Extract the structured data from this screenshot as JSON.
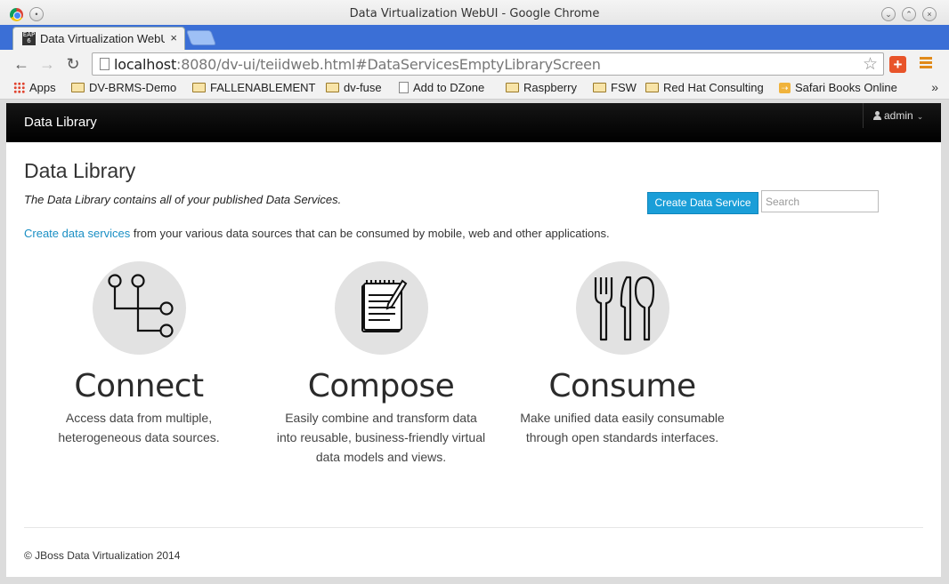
{
  "window": {
    "title": "Data Virtualization WebUI - Google Chrome"
  },
  "tab": {
    "title": "Data Virtualization WebUI",
    "favicon_text": "EAP 6"
  },
  "omnibox": {
    "host": "localhost",
    "path": ":8080/dv-ui/teiidweb.html#DataServicesEmptyLibraryScreen"
  },
  "bookmarks": [
    {
      "label": "Apps",
      "icon": "apps-grid-icon"
    },
    {
      "label": "DV-BRMS-Demo",
      "icon": "folder-icon"
    },
    {
      "label": "FALLENABLEMENT",
      "icon": "folder-icon"
    },
    {
      "label": "dv-fuse",
      "icon": "folder-icon"
    },
    {
      "label": "Add to DZone",
      "icon": "page-icon"
    },
    {
      "label": "Raspberry",
      "icon": "folder-icon"
    },
    {
      "label": "FSW",
      "icon": "folder-icon"
    },
    {
      "label": "Red Hat Consulting",
      "icon": "folder-icon"
    },
    {
      "label": "Safari Books Online",
      "icon": "safari-icon"
    }
  ],
  "app": {
    "brand": "Data Library",
    "user": "admin"
  },
  "page": {
    "title": "Data Library",
    "lead": "The Data Library contains all of your published Data Services.",
    "create_button": "Create Data Service",
    "search_placeholder": "Search",
    "intro_link": "Create data services",
    "intro_rest": " from your various data sources that can be consumed by mobile, web and other applications."
  },
  "features": [
    {
      "title": "Connect",
      "desc": [
        "Access data from multiple,",
        "heterogeneous data sources."
      ],
      "icon": "connect-tree-icon"
    },
    {
      "title": "Compose",
      "desc": [
        "Easily combine and transform data",
        "into reusable, business-friendly virtual",
        "data models and views."
      ],
      "icon": "notepad-icon"
    },
    {
      "title": "Consume",
      "desc": [
        "Make unified data easily consumable",
        "through open standards interfaces."
      ],
      "icon": "utensils-icon"
    }
  ],
  "footer": "© JBoss Data Virtualization 2014",
  "colors": {
    "accent": "#1a9ed8",
    "nav_bg": "#000000",
    "link": "#1a8fc4"
  }
}
